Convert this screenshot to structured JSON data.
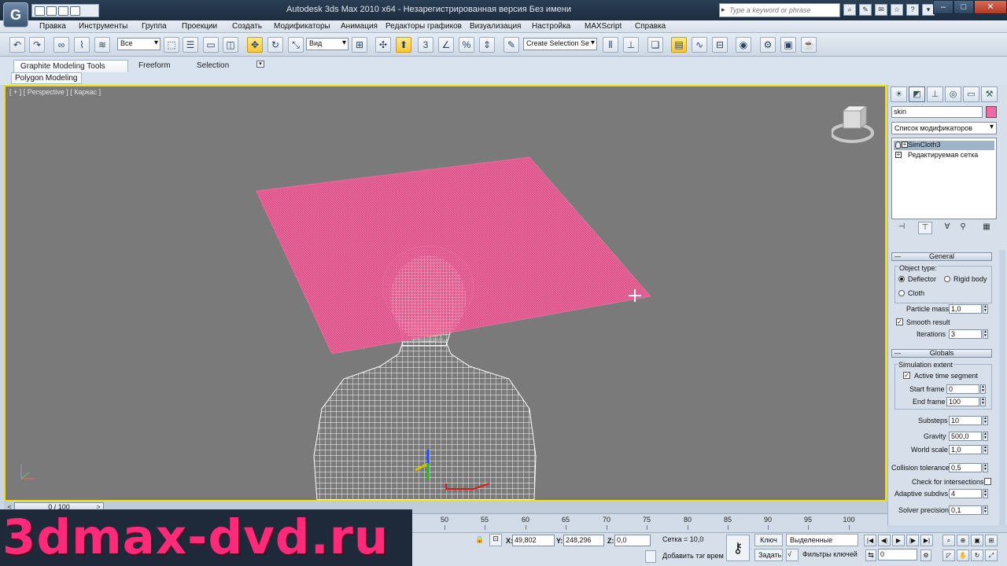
{
  "titlebar": {
    "title": "Autodesk 3ds Max  2010 x64     - Незарегистрированная версия      Без имени",
    "search_placeholder": "Type a keyword or phrase"
  },
  "menu": [
    "Правка",
    "Инструменты",
    "Группа",
    "Проекции",
    "Создать",
    "Модификаторы",
    "Анимация",
    "Редакторы графиков",
    "Визуализация",
    "Настройка",
    "MAXScript",
    "Справка"
  ],
  "toolbar": {
    "selection_filter": "Все",
    "ref_coord": "Вид",
    "snap_label": "3",
    "named_selection": "Create Selection Se"
  },
  "ribbon": {
    "tabs": [
      "Graphite Modeling Tools",
      "Freeform",
      "Selection"
    ],
    "sub_tab": "Polygon Modeling"
  },
  "viewport": {
    "label": "[ + ] [ Perspective ] [ Каркас ]",
    "cloth_color": "#e8508c",
    "mesh_color": "#ffffff",
    "border_color": "#f0e100"
  },
  "command_panel": {
    "object_name": "skin",
    "object_color": "#f06aa8",
    "modifier_list": "Список модификаторов",
    "stack": [
      "SimCloth3",
      "Редактируемая сетка"
    ],
    "general": {
      "title": "General",
      "object_type": "Object type:",
      "deflector": "Deflector",
      "rigid_body": "Rigid body",
      "cloth": "Cloth",
      "particle_mass_label": "Particle mass",
      "particle_mass": "1,0",
      "smooth_result": "Smooth result",
      "iterations_label": "Iterations",
      "iterations": "3"
    },
    "globals": {
      "title": "Globals",
      "sim_extent": "Simulation extent",
      "active_segment": "Active time segment",
      "start_frame_label": "Start frame",
      "start_frame": "0",
      "end_frame_label": "End frame",
      "end_frame": "100",
      "substeps_label": "Substeps",
      "substeps": "10",
      "gravity_label": "Gravity",
      "gravity": "500,0",
      "world_scale_label": "World scale",
      "world_scale": "1,0",
      "collision_tol_label": "Collision tolerance",
      "collision_tol": "0,5",
      "check_intersections": "Check for intersections",
      "adaptive_subdivs_label": "Adaptive subdivs",
      "adaptive_subdivs": "4",
      "solver_precision_label": "Solver precision",
      "solver_precision": "0,1"
    }
  },
  "timeline": {
    "slider": "0 / 100",
    "ticks": [
      "50",
      "55",
      "60",
      "65",
      "70",
      "75",
      "80",
      "85",
      "90",
      "95",
      "100"
    ]
  },
  "status": {
    "x_label": "X:",
    "x": "49,802",
    "y_label": "Y:",
    "y": "248,296",
    "z_label": "Z:",
    "z": "0,0",
    "grid": "Сетка = 10,0",
    "key_label": "Ключ",
    "set_label": "Задать",
    "key_mode": "Выделенные",
    "key_filters": "Фильтры ключей",
    "add_tag": "Добавить тэг врем",
    "frame": "0"
  },
  "watermark": "3dmax-dvd.ru"
}
